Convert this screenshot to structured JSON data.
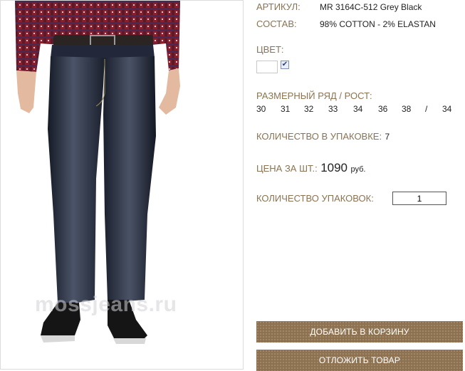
{
  "product": {
    "watermark": "mossjeans.ru",
    "article_label": "АРТИКУЛ:",
    "article_value": "MR 3164C-512 Grey Black",
    "composition_label": "СОСТАВ:",
    "composition_value": "98% COTTON - 2% ELASTAN",
    "color_label": "ЦВЕТ:",
    "color_checked": true,
    "size_label": "РАЗМЕРНЫЙ РЯД / РОСТ:",
    "sizes": [
      "30",
      "31",
      "32",
      "33",
      "34",
      "36",
      "38",
      "/",
      "34"
    ],
    "pack_qty_label": "КОЛИЧЕСТВО В УПАКОВКЕ:",
    "pack_qty_value": "7",
    "price_label": "ЦЕНА ЗА ШТ.:",
    "price_value": "1090",
    "price_currency": "руб.",
    "packs_label": "КОЛИЧЕСТВО УПАКОВОК:",
    "packs_value": "1"
  },
  "actions": {
    "add_to_cart": "ДОБАВИТЬ В КОРЗИНУ",
    "postpone": "ОТЛОЖИТЬ ТОВАР"
  },
  "colors": {
    "label": "#8a7352",
    "button": "#8e7250"
  }
}
